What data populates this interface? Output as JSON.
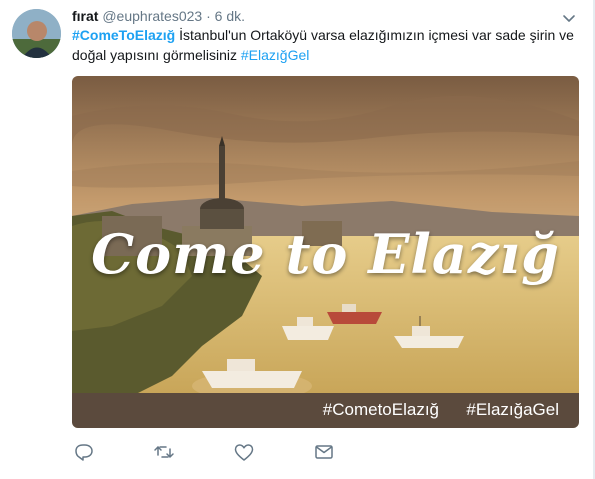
{
  "tweet": {
    "display_name": "fırat",
    "handle": "@euphrates023",
    "separator": "·",
    "time": "6 dk.",
    "text_hashtag": "#ComeToElazığ",
    "text_body": " İstanbul'un Ortaköyü varsa elazığımızın içmesi var sade şirin ve doğal yapısını görmelisiniz ",
    "text_hashtag2": "#ElazığGel"
  },
  "media": {
    "title": "Come to Elazığ",
    "bar_tag1": "#CometoElazığ",
    "bar_tag2": "#ElazığaGel"
  },
  "actions": {
    "icons": [
      "reply-icon",
      "retweet-icon",
      "like-icon",
      "message-icon"
    ]
  },
  "colors": {
    "link": "#1da1f2",
    "text": "#14171a",
    "muted": "#657786",
    "icon": "#657786"
  }
}
